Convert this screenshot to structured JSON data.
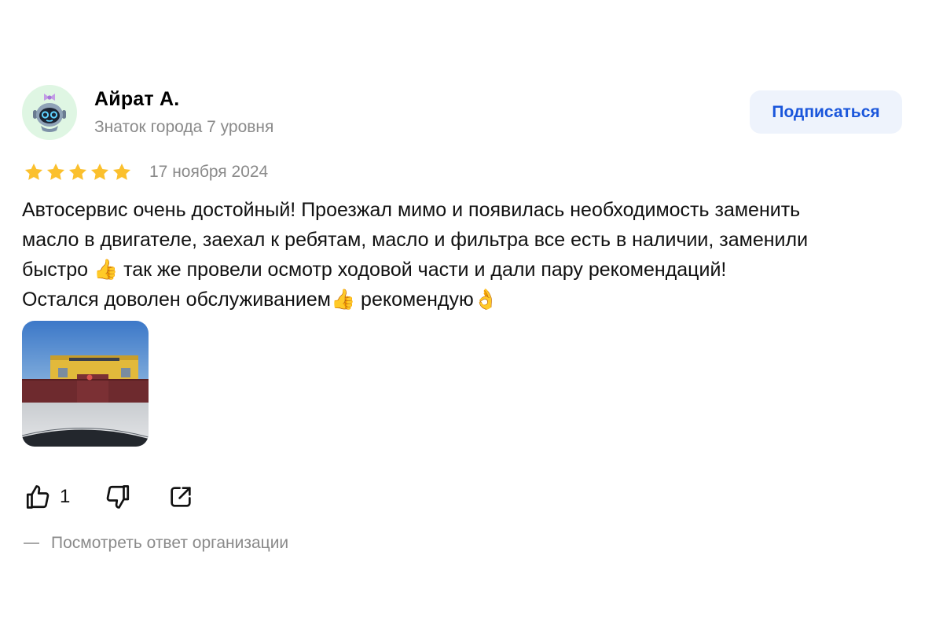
{
  "author": {
    "name": "Айрат А.",
    "level": "Знаток города 7 уровня",
    "avatar_icon": "robot-avatar-icon"
  },
  "subscribe_label": "Подписаться",
  "rating": {
    "value": 5,
    "max": 5,
    "star_color": "#fbc02d"
  },
  "date": "17 ноября 2024",
  "review_text": {
    "line1": "Автосервис очень достойный! Проезжал мимо и появилась необходимость заменить",
    "line2": "масло в двигателе, заехал к ребятам, масло и фильтра все есть в наличии, заменили",
    "line3_a": "быстро",
    "line3_emoji": "👍",
    "line3_b": "так же провели осмотр ходовой части и дали пару рекомендаций!",
    "line4_a": "Остался доволен обслуживанием",
    "line4_emoji1": "👍",
    "line4_b": "рекомендую",
    "line4_emoji2": "👌"
  },
  "photos": [
    {
      "icon": "service-building-photo"
    }
  ],
  "actions": {
    "like_icon": "thumbs-up-icon",
    "like_count": "1",
    "dislike_icon": "thumbs-down-icon",
    "share_icon": "share-icon"
  },
  "org_reply_label": "Посмотреть ответ организации",
  "colors": {
    "accent": "#1a56db",
    "button_bg": "#eef3fc",
    "muted_text": "#8a8a8a",
    "avatar_bg": "#dff6e3"
  }
}
